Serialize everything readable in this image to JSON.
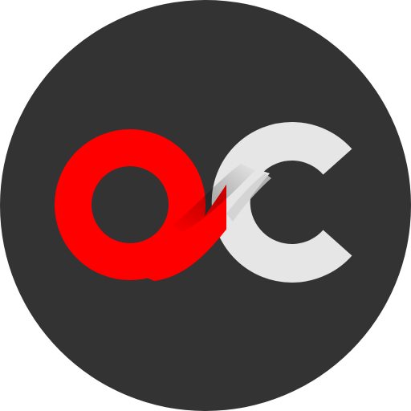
{
  "logo": {
    "name": "oc-logo",
    "letters": "OC",
    "colors": {
      "background": "#333333",
      "red": "#ff0000",
      "light": "#e6e6e6",
      "fold_shadow": "#b90000",
      "fold_highlight": "#cfcfcf"
    }
  }
}
